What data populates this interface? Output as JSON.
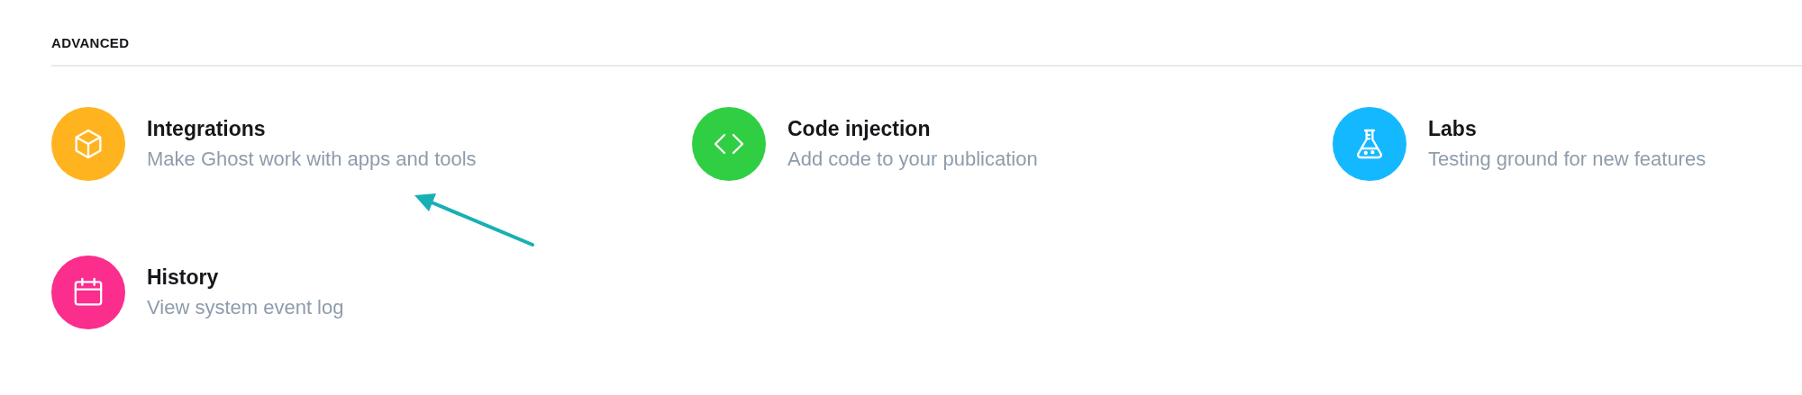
{
  "section": {
    "title": "ADVANCED"
  },
  "items": [
    {
      "kind": "cube",
      "color": "#ffb41f",
      "title": "Integrations",
      "description": "Make Ghost work with apps and tools"
    },
    {
      "kind": "code",
      "color": "#30cf43",
      "title": "Code injection",
      "description": "Add code to your publication"
    },
    {
      "kind": "flask",
      "color": "#14b8ff",
      "title": "Labs",
      "description": "Testing ground for new features"
    },
    {
      "kind": "calendar",
      "color": "#fb2d8d",
      "title": "History",
      "description": "View system event log"
    }
  ]
}
